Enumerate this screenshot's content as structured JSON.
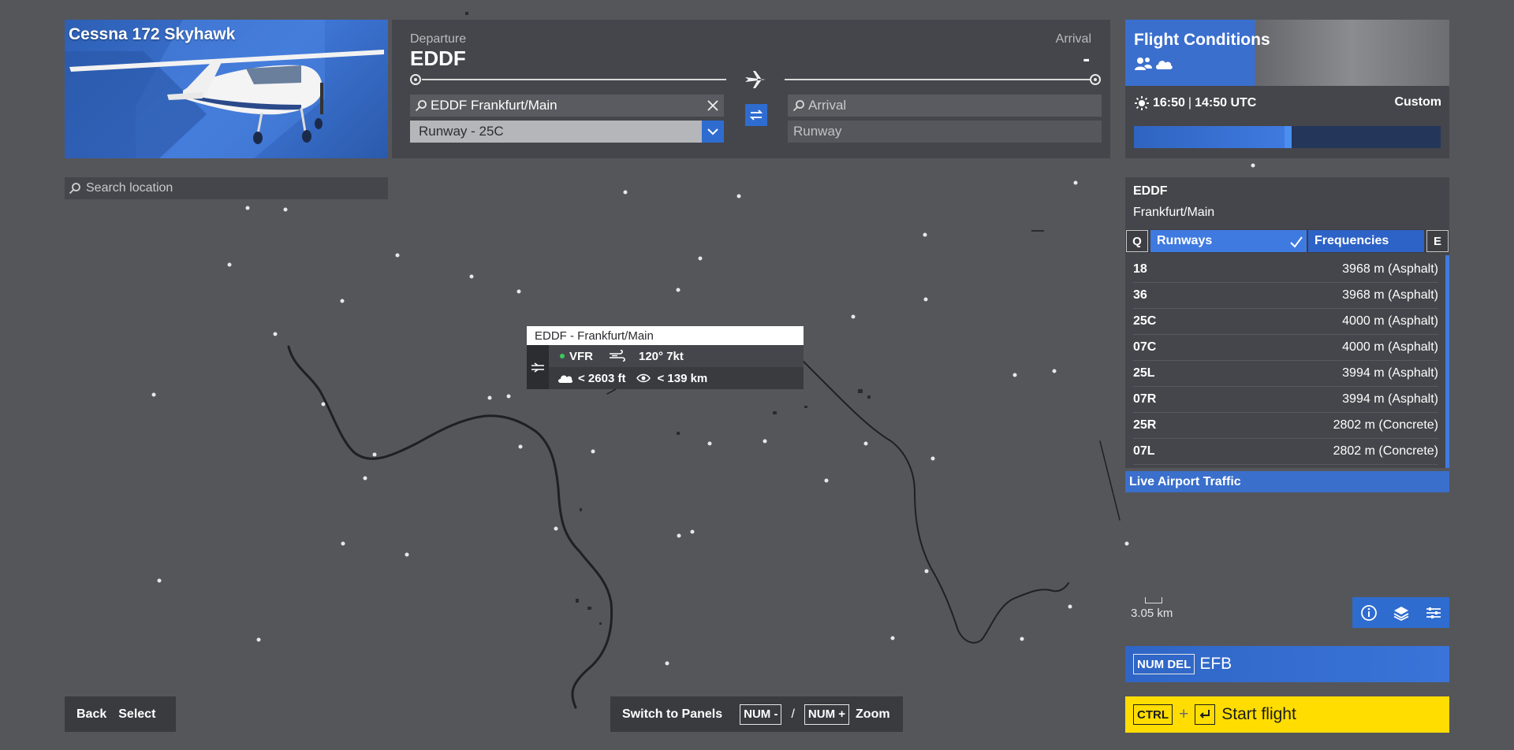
{
  "aircraft": {
    "name": "Cessna 172 Skyhawk"
  },
  "flight_plan": {
    "departure_label": "Departure",
    "departure_code": "EDDF",
    "arrival_label": "Arrival",
    "arrival_code": "-",
    "departure_search_value": "EDDF Frankfurt/Main",
    "departure_runway": "Runway - 25C",
    "arrival_search_placeholder": "Arrival",
    "arrival_runway": "Runway"
  },
  "conditions": {
    "title": "Flight Conditions",
    "local_time": "16:50",
    "separator": "|",
    "utc_time": "14:50 UTC",
    "mode": "Custom",
    "time_progress": 0.49
  },
  "search_location": {
    "placeholder": "Search location"
  },
  "airport": {
    "icao": "EDDF",
    "name": "Frankfurt/Main",
    "key_left": "Q",
    "key_right": "E",
    "tab_runways": "Runways",
    "tab_frequencies": "Frequencies",
    "runways": [
      {
        "id": "18",
        "info": "3968 m (Asphalt)"
      },
      {
        "id": "36",
        "info": "3968 m (Asphalt)"
      },
      {
        "id": "25C",
        "info": "4000 m (Asphalt)"
      },
      {
        "id": "07C",
        "info": "4000 m (Asphalt)"
      },
      {
        "id": "25L",
        "info": "3994 m (Asphalt)"
      },
      {
        "id": "07R",
        "info": "3994 m (Asphalt)"
      },
      {
        "id": "25R",
        "info": "2802 m (Concrete)"
      },
      {
        "id": "07L",
        "info": "2802 m (Concrete)"
      }
    ],
    "live_traffic": "Live Airport Traffic"
  },
  "tooltip": {
    "title": "EDDF - Frankfurt/Main",
    "flight_rules": "VFR",
    "wind": "120° 7kt",
    "ceiling": "< 2603 ft",
    "visibility": "< 139 km"
  },
  "map": {
    "scale": "3.05 km"
  },
  "efb": {
    "key": "NUM DEL",
    "label": "EFB"
  },
  "start_flight": {
    "key1": "CTRL",
    "plus": "+",
    "key2_icon": "enter-icon",
    "label": "Start flight"
  },
  "footer": {
    "back": "Back",
    "select": "Select",
    "switch_panels": "Switch to Panels",
    "num_minus": "NUM -",
    "slash": "/",
    "num_plus": "NUM +",
    "zoom": "Zoom"
  },
  "colors": {
    "accent": "#3f7ae0",
    "start": "#ffdd00",
    "panel": "#45464b",
    "map": "#55565a"
  }
}
